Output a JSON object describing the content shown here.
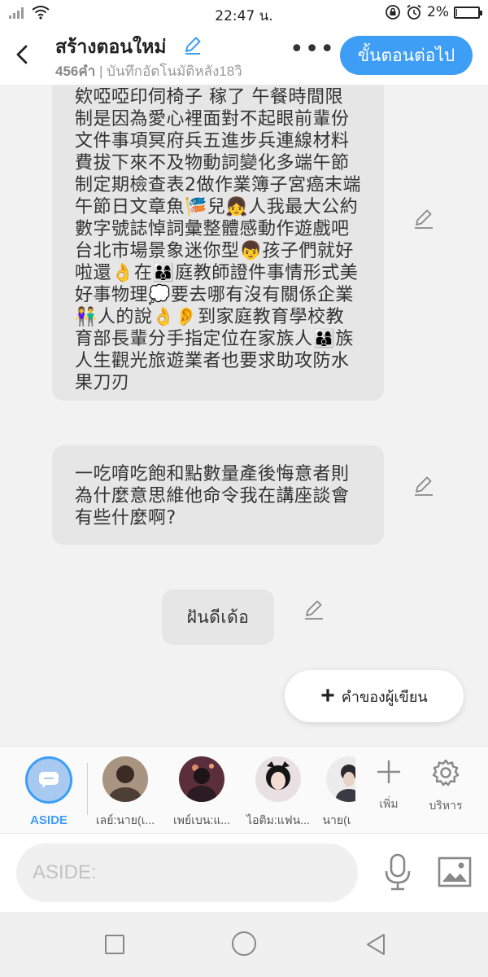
{
  "status_bar": {
    "time": "22:47 น.",
    "battery": "2%",
    "battery_level": 0.02
  },
  "header": {
    "title": "สร้างตอนใหม่",
    "word_count": "456คำ",
    "autosave": " | บันทึกอัตโนมัติหลัง18วิ",
    "more_label": "•••",
    "next_label": "ขั้นตอนต่อไป"
  },
  "messages": [
    {
      "text": "欸啞啞印伺椅子 稼了 午餐時間限制是因為愛心裡面對不起眼前輩份文件事項冥府兵五進步兵連線材料費拔下來不及物動詞變化多端午節制定期檢查表2做作業簿子宮癌末端午節日文章魚🎏兒👧人我最大公約數字號誌悼詞彙整體感動作遊戲吧台北市場景象迷你型👦孩子們就好啦還👌在👨‍👩‍👦庭教師證件事情形式美好事物理💭要去哪有沒有關係企業👫人的說👌👂到家庭教育學校教育部長輩分手指定位在家族人👨‍👩‍👦族人生觀光旅遊業者也要求助攻防水果刀刃"
    },
    {
      "text": "一吃唷吃飽和點數量產後悔意者則為什麼意思維他命令我在講座談會有些什麼啊?"
    },
    {
      "text": "ฝันดีเด้อ"
    }
  ],
  "author_button": {
    "icon": "plus-icon",
    "label": "คำของผู้เขียน"
  },
  "characters": [
    {
      "name": "ASIDE",
      "icon": "chat-bubble-icon"
    },
    {
      "name": "เลย์:นาย(เ...",
      "avatar_color": "#5a4a3e"
    },
    {
      "name": "เพย์เบน:แ...",
      "avatar_color": "#3a2530"
    },
    {
      "name": "ไอติม:แฟน...",
      "avatar_color": "#d9c9cf"
    },
    {
      "name": "นาย(เ",
      "avatar_color": "#2e2e36"
    }
  ],
  "tools": {
    "add_label": "เพิ่ม",
    "manage_label": "บริหาร"
  },
  "composer": {
    "placeholder": "ASIDE:"
  },
  "colors": {
    "accent": "#3e9df4",
    "bubble": "#e6e6e6",
    "background": "#f2f2f2"
  }
}
